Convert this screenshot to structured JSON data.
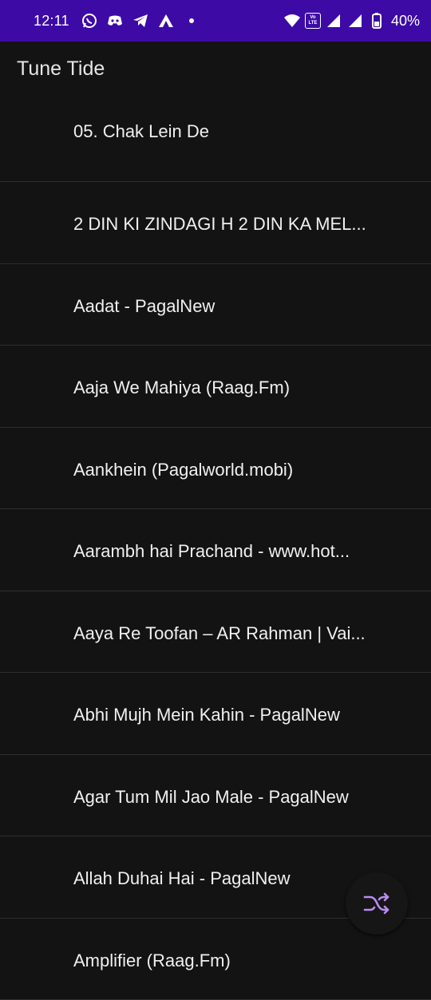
{
  "status_bar": {
    "time": "12:11",
    "battery_percent": "40%",
    "volte_line1": "Vo",
    "volte_line2": "LTE",
    "background_color": "#3d0aa6"
  },
  "app": {
    "title": "Tune Tide"
  },
  "songs": [
    {
      "title": "05. Chak Lein De"
    },
    {
      "title": "2 DIN KI ZINDAGI H 2 DIN KA MEL..."
    },
    {
      "title": "Aadat - PagalNew"
    },
    {
      "title": "Aaja We Mahiya (Raag.Fm)"
    },
    {
      "title": "Aankhein (Pagalworld.mobi)"
    },
    {
      "title": "Aarambh hai Prachand - www.hot..."
    },
    {
      "title": "Aaya Re Toofan – AR Rahman | Vai..."
    },
    {
      "title": "Abhi Mujh Mein Kahin - PagalNew"
    },
    {
      "title": "Agar Tum Mil Jao Male - PagalNew"
    },
    {
      "title": "Allah Duhai Hai - PagalNew"
    },
    {
      "title": "Amplifier (Raag.Fm)"
    }
  ],
  "fab": {
    "icon": "shuffle-icon",
    "icon_color": "#b98cf0"
  }
}
